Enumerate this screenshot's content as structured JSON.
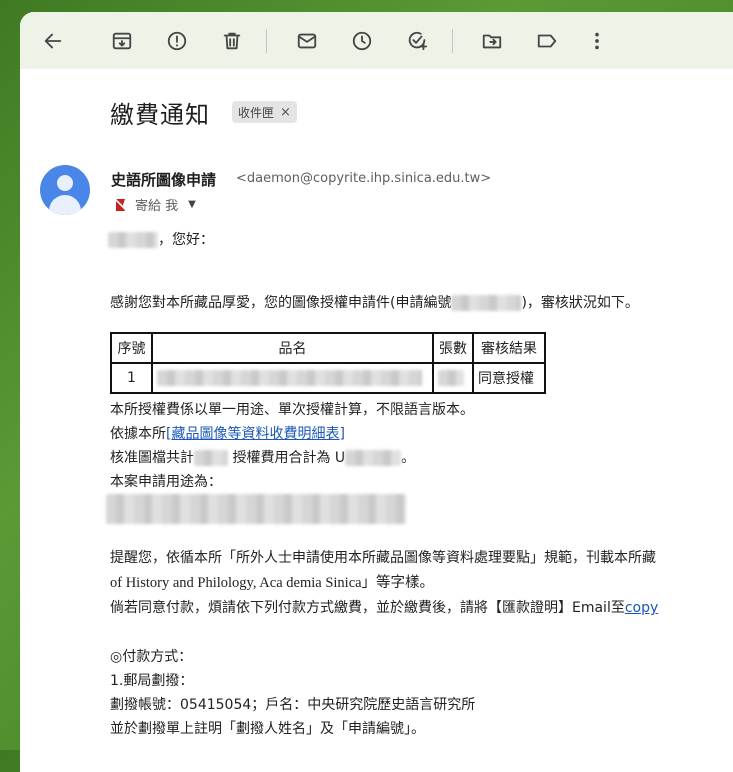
{
  "toolbar": {
    "icons": [
      "back-icon",
      "archive-icon",
      "report-spam-icon",
      "delete-icon",
      "mark-unread-icon",
      "snooze-icon",
      "add-task-icon",
      "move-to-icon",
      "label-icon",
      "more-vert-icon"
    ]
  },
  "email": {
    "subject": "繳費通知",
    "label_chip": "收件匣",
    "label_close": "×",
    "sender_name": "史語所圖像申請",
    "sender_email": "<daemon@copyrite.ihp.sinica.edu.tw>",
    "to_text": "寄給 我",
    "greeting_suffix": "，您好：",
    "thanks_line_a": "感謝您對本所藏品厚愛，您的圖像授權申請件(申請編號",
    "thanks_line_b": ")，審核狀況如下。",
    "table": {
      "headers": [
        "序號",
        "品名",
        "張數",
        "審核結果"
      ],
      "rows": [
        [
          "1",
          "",
          "",
          "同意授權"
        ]
      ]
    },
    "line_fee_rule": "本所授權費係以單一用途、單次授權計算，不限語言版本。",
    "line_per_a": "依據本所",
    "line_per_link": "[藏品圖像等資料收費明細表]",
    "line_approve_a": "核准圖檔共計",
    "line_approve_b": "授權費用合計為 U",
    "line_approve_c": "。",
    "line_usage": "本案申請用途為：",
    "remind_line1": "提醒您，依循本所「所外人士申請使用本所藏品圖像等資料處理要點」規範，刊載本所藏",
    "remind_line2": "of History and Philology, Aca demia Sinica」等字樣。",
    "remind_line3_a": "倘若同意付款，煩請依下列付款方式繳費，並於繳費後，請將【匯款證明】Email至",
    "remind_line3_link": "copy",
    "pay_title": "◎付款方式：",
    "pay_1": "1.郵局劃撥：",
    "pay_acct": "劃撥帳號：05415054；戶名：中央研究院歷史語言研究所",
    "pay_note": "並於劃撥單上註明「劃撥人姓名」及「申請編號」。"
  }
}
